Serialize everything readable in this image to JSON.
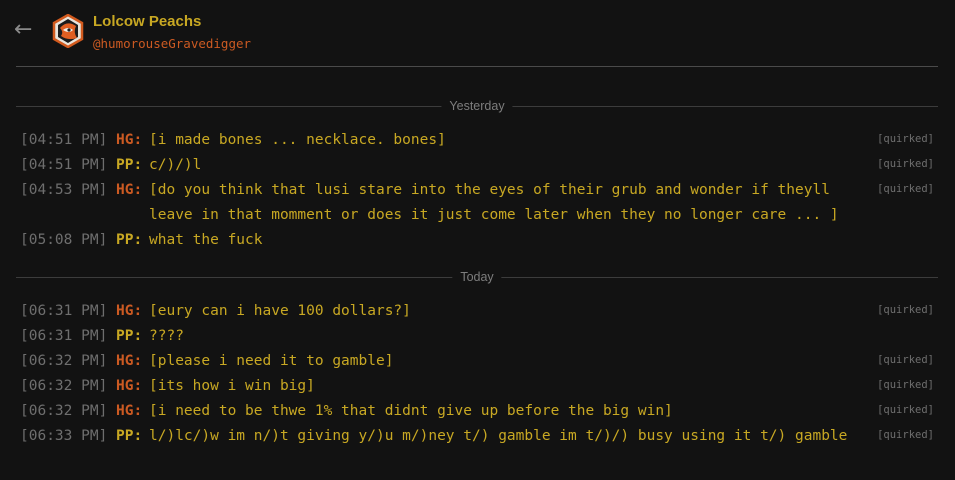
{
  "header": {
    "back_icon": "←",
    "name": "Lolcow Peachs",
    "handle": "@humorouseGravedigger"
  },
  "dividers": [
    "Yesterday",
    "Today"
  ],
  "messages": [
    {
      "time": "[04:51 PM]",
      "who": "HG:",
      "text": "[i made bones ... necklace. bones]",
      "tag": "[quirked]"
    },
    {
      "time": "[04:51 PM]",
      "who": "PP:",
      "text": "c/)/)l",
      "tag": "[quirked]"
    },
    {
      "time": "[04:53 PM]",
      "who": "HG:",
      "text": "[do you think that lusi stare into the eyes of their grub and wonder if theyll leave in that momment or does it just come later when they no longer care ... ]",
      "tag": "[quirked]"
    },
    {
      "time": "[05:08 PM]",
      "who": "PP:",
      "text": "what the fuck",
      "tag": ""
    },
    {
      "time": "[06:31 PM]",
      "who": "HG:",
      "text": "[eury can i have 100 dollars?]",
      "tag": "[quirked]"
    },
    {
      "time": "[06:31 PM]",
      "who": "PP:",
      "text": "????",
      "tag": ""
    },
    {
      "time": "[06:32 PM]",
      "who": "HG:",
      "text": "[please i need it to gamble]",
      "tag": "[quirked]"
    },
    {
      "time": "[06:32 PM]",
      "who": "HG:",
      "text": "[its how i win big]",
      "tag": "[quirked]"
    },
    {
      "time": "[06:32 PM]",
      "who": "HG:",
      "text": "[i need to be thwe 1% that didnt give up before the big win]",
      "tag": "[quirked]"
    },
    {
      "time": "[06:33 PM]",
      "who": "PP:",
      "text": "l/)lc/)w im n/)t giving y/)u m/)ney t/) gamble im t/)/) busy using it t/) gamble",
      "tag": "[quirked]"
    }
  ]
}
